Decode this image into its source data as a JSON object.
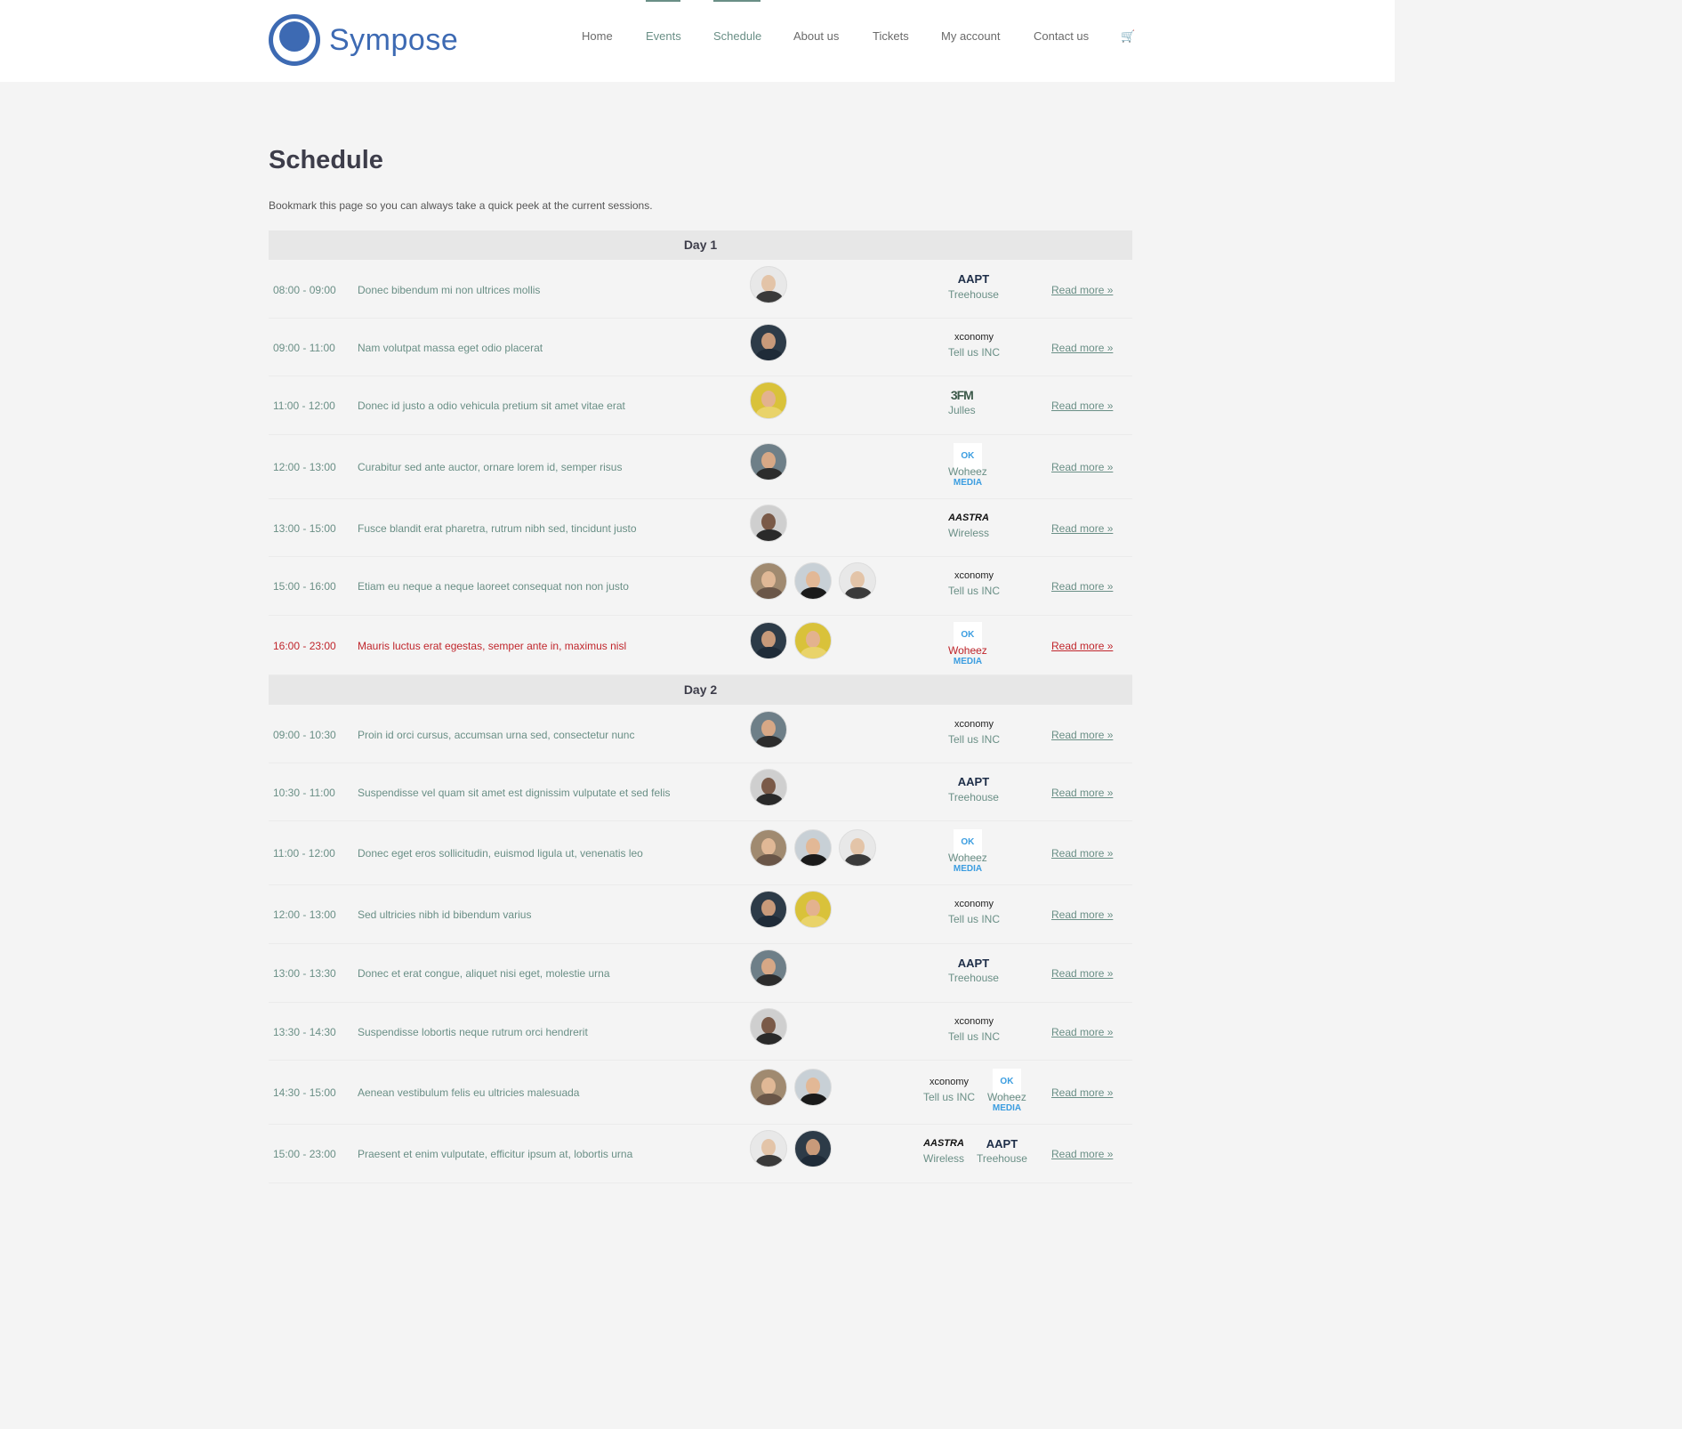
{
  "brand": {
    "name": "Sympose"
  },
  "nav": {
    "items": [
      {
        "label": "Home"
      },
      {
        "label": "Events"
      },
      {
        "label": "Schedule"
      },
      {
        "label": "About us"
      },
      {
        "label": "Tickets"
      },
      {
        "label": "My account"
      },
      {
        "label": "Contact us"
      }
    ],
    "active": "Schedule",
    "cart_icon": "cart-icon"
  },
  "page": {
    "title": "Schedule",
    "intro": "Bookmark this page so you can always take a quick peek at the current sessions."
  },
  "read_more_label": "Read more »",
  "days": [
    {
      "label": "Day 1",
      "sessions": [
        {
          "time": "08:00 - 09:00",
          "title": "Donec bibendum mi non ultrices mollis",
          "speakers": 1,
          "sponsors": [
            {
              "logo": "AAPT",
              "name": "Treehouse"
            }
          ]
        },
        {
          "time": "09:00 - 11:00",
          "title": "Nam volutpat massa eget odio placerat",
          "speakers": 1,
          "sponsors": [
            {
              "logo": "xconomy",
              "name": "Tell us INC"
            }
          ]
        },
        {
          "time": "11:00 - 12:00",
          "title": "Donec id justo a odio vehicula pretium sit amet vitae erat",
          "speakers": 1,
          "sponsors": [
            {
              "logo": "3FM",
              "name": "Julles"
            }
          ]
        },
        {
          "time": "12:00 - 13:00",
          "title": "Curabitur sed ante auctor, ornare lorem id, semper risus",
          "speakers": 1,
          "sponsors": [
            {
              "logo": "OK MEDIA",
              "name": "Woheez"
            }
          ]
        },
        {
          "time": "13:00 - 15:00",
          "title": "Fusce blandit erat pharetra, rutrum nibh sed, tincidunt justo",
          "speakers": 1,
          "sponsors": [
            {
              "logo": "AASTRA",
              "name": "Wireless"
            }
          ]
        },
        {
          "time": "15:00 - 16:00",
          "title": "Etiam eu neque a neque laoreet consequat non non justo",
          "speakers": 3,
          "sponsors": [
            {
              "logo": "xconomy",
              "name": "Tell us INC"
            }
          ]
        },
        {
          "time": "16:00 - 23:00",
          "title": "Mauris luctus erat egestas, semper ante in, maximus nisl",
          "speakers": 2,
          "highlight": true,
          "sponsors": [
            {
              "logo": "OK MEDIA",
              "name": "Woheez"
            }
          ]
        }
      ]
    },
    {
      "label": "Day 2",
      "sessions": [
        {
          "time": "09:00 - 10:30",
          "title": "Proin id orci cursus, accumsan urna sed, consectetur nunc",
          "speakers": 1,
          "sponsors": [
            {
              "logo": "xconomy",
              "name": "Tell us INC"
            }
          ]
        },
        {
          "time": "10:30 - 11:00",
          "title": "Suspendisse vel quam sit amet est dignissim vulputate et sed felis",
          "speakers": 1,
          "sponsors": [
            {
              "logo": "AAPT",
              "name": "Treehouse"
            }
          ]
        },
        {
          "time": "11:00 - 12:00",
          "title": "Donec eget eros sollicitudin, euismod ligula ut, venenatis leo",
          "speakers": 3,
          "sponsors": [
            {
              "logo": "OK MEDIA",
              "name": "Woheez"
            }
          ]
        },
        {
          "time": "12:00 - 13:00",
          "title": "Sed ultricies nibh id bibendum varius",
          "speakers": 2,
          "sponsors": [
            {
              "logo": "xconomy",
              "name": "Tell us INC"
            }
          ]
        },
        {
          "time": "13:00 - 13:30",
          "title": "Donec et erat congue, aliquet nisi eget, molestie urna",
          "speakers": 1,
          "sponsors": [
            {
              "logo": "AAPT",
              "name": "Treehouse"
            }
          ]
        },
        {
          "time": "13:30 - 14:30",
          "title": "Suspendisse lobortis neque rutrum orci hendrerit",
          "speakers": 1,
          "sponsors": [
            {
              "logo": "xconomy",
              "name": "Tell us INC"
            }
          ]
        },
        {
          "time": "14:30 - 15:00",
          "title": "Aenean vestibulum felis eu ultricies malesuada",
          "speakers": 2,
          "sponsors": [
            {
              "logo": "xconomy",
              "name": "Tell us INC"
            },
            {
              "logo": "OK MEDIA",
              "name": "Woheez"
            }
          ]
        },
        {
          "time": "15:00 - 23:00",
          "title": "Praesent et enim vulputate, efficitur ipsum at, lobortis urna",
          "speakers": 2,
          "sponsors": [
            {
              "logo": "AASTRA",
              "name": "Wireless"
            },
            {
              "logo": "AAPT",
              "name": "Treehouse"
            }
          ]
        }
      ]
    }
  ]
}
